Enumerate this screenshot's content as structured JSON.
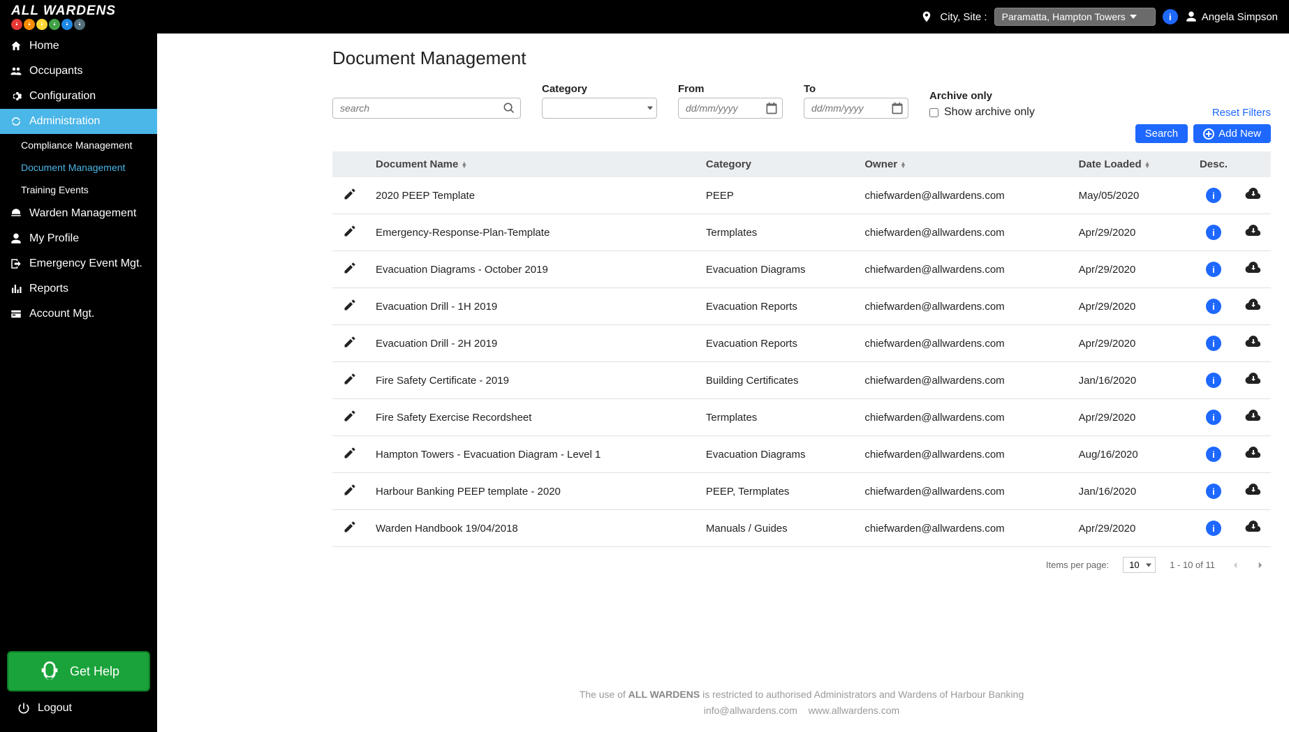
{
  "brand": "ALL WARDENS",
  "header": {
    "city_label": "City, Site :",
    "site_value": "Paramatta, Hampton Towers",
    "username": "Angela Simpson"
  },
  "sidebar": {
    "items": [
      {
        "label": "Home",
        "icon": "home"
      },
      {
        "label": "Occupants",
        "icon": "users"
      },
      {
        "label": "Configuration",
        "icon": "gear"
      },
      {
        "label": "Administration",
        "icon": "cycle",
        "active": true,
        "children": [
          {
            "label": "Compliance Management"
          },
          {
            "label": "Document Management",
            "current": true
          },
          {
            "label": "Training Events"
          }
        ]
      },
      {
        "label": "Warden Management",
        "icon": "helmet"
      },
      {
        "label": "My Profile",
        "icon": "person"
      },
      {
        "label": "Emergency Event Mgt.",
        "icon": "exit"
      },
      {
        "label": "Reports",
        "icon": "bars"
      },
      {
        "label": "Account Mgt.",
        "icon": "card"
      }
    ],
    "help_label": "Get Help",
    "logout_label": "Logout"
  },
  "page": {
    "title": "Document Management",
    "search_placeholder": "search",
    "filters": {
      "category_label": "Category",
      "from_label": "From",
      "to_label": "To",
      "date_placeholder": "dd/mm/yyyy",
      "archive_label": "Archive only",
      "archive_checkbox_label": "Show archive only",
      "reset_label": "Reset Filters"
    },
    "actions": {
      "search": "Search",
      "add_new": "Add New"
    },
    "columns": {
      "doc_name": "Document Name",
      "category": "Category",
      "owner": "Owner",
      "date_loaded": "Date Loaded",
      "desc": "Desc."
    },
    "rows": [
      {
        "name": "2020 PEEP Template",
        "category": "PEEP",
        "owner": "chiefwarden@allwardens.com",
        "date": "May/05/2020"
      },
      {
        "name": "Emergency-Response-Plan-Template",
        "category": "Termplates",
        "owner": "chiefwarden@allwardens.com",
        "date": "Apr/29/2020"
      },
      {
        "name": "Evacuation Diagrams - October 2019",
        "category": "Evacuation Diagrams",
        "owner": "chiefwarden@allwardens.com",
        "date": "Apr/29/2020"
      },
      {
        "name": "Evacuation Drill - 1H 2019",
        "category": "Evacuation Reports",
        "owner": "chiefwarden@allwardens.com",
        "date": "Apr/29/2020"
      },
      {
        "name": "Evacuation Drill - 2H 2019",
        "category": "Evacuation Reports",
        "owner": "chiefwarden@allwardens.com",
        "date": "Apr/29/2020"
      },
      {
        "name": "Fire Safety Certificate - 2019",
        "category": "Building Certificates",
        "owner": "chiefwarden@allwardens.com",
        "date": "Jan/16/2020"
      },
      {
        "name": "Fire Safety Exercise Recordsheet",
        "category": "Termplates",
        "owner": "chiefwarden@allwardens.com",
        "date": "Apr/29/2020"
      },
      {
        "name": "Hampton Towers - Evacuation Diagram - Level 1",
        "category": "Evacuation Diagrams",
        "owner": "chiefwarden@allwardens.com",
        "date": "Aug/16/2020"
      },
      {
        "name": "Harbour Banking PEEP template - 2020",
        "category": "PEEP, Termplates",
        "owner": "chiefwarden@allwardens.com",
        "date": "Jan/16/2020"
      },
      {
        "name": "Warden Handbook 19/04/2018",
        "category": "Manuals / Guides",
        "owner": "chiefwarden@allwardens.com",
        "date": "Apr/29/2020"
      }
    ],
    "pager": {
      "items_per_page_label": "Items per page:",
      "page_size": "10",
      "range_text": "1 - 10 of 11"
    }
  },
  "footer": {
    "prefix": "The use of ",
    "brand": "ALL WARDENS",
    "suffix": " is restricted to authorised Administrators and Wardens of Harbour Banking",
    "email": "info@allwardens.com",
    "website": "www.allwardens.com"
  },
  "logo_colors": [
    "#e53935",
    "#fb8c00",
    "#fdd835",
    "#43a047",
    "#1e88e5",
    "#546e7a"
  ]
}
